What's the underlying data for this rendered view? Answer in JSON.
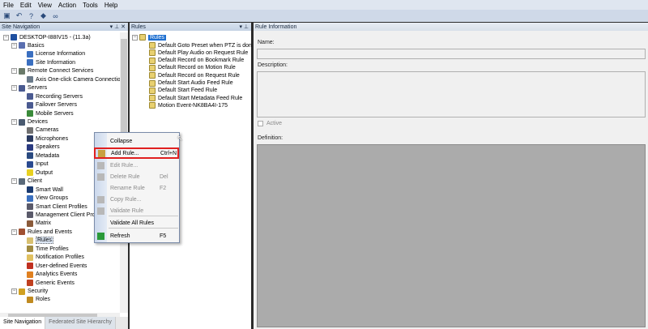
{
  "menu": [
    "File",
    "Edit",
    "View",
    "Action",
    "Tools",
    "Help"
  ],
  "toolbar": [
    "save-icon",
    "undo-icon",
    "help-icon",
    "tools-icon",
    "binoculars-icon"
  ],
  "left_panel": {
    "title": "Site Navigation",
    "tree": [
      {
        "label": "DESKTOP-I88IV15 - (11.3a)",
        "level": 0,
        "exp": "−",
        "color": "#1e4fa0"
      },
      {
        "label": "Basics",
        "level": 1,
        "exp": "−",
        "color": "#5a6fb0"
      },
      {
        "label": "License Information",
        "level": 2,
        "color": "#3a6fc0"
      },
      {
        "label": "Site Information",
        "level": 2,
        "color": "#3a6fc0"
      },
      {
        "label": "Remote Connect Services",
        "level": 1,
        "exp": "−",
        "color": "#6a7a6a"
      },
      {
        "label": "Axis One-click Camera Connectio",
        "level": 2,
        "color": "#6a7a8a"
      },
      {
        "label": "Servers",
        "level": 1,
        "exp": "−",
        "color": "#4a5a90"
      },
      {
        "label": "Recording Servers",
        "level": 2,
        "color": "#4a5a90"
      },
      {
        "label": "Failover Servers",
        "level": 2,
        "color": "#4a5a90"
      },
      {
        "label": "Mobile Servers",
        "level": 2,
        "color": "#3a8a3a"
      },
      {
        "label": "Devices",
        "level": 1,
        "exp": "−",
        "color": "#4a5a70"
      },
      {
        "label": "Cameras",
        "level": 2,
        "color": "#707070"
      },
      {
        "label": "Microphones",
        "level": 2,
        "color": "#2a3a60"
      },
      {
        "label": "Speakers",
        "level": 2,
        "color": "#2a3a80"
      },
      {
        "label": "Metadata",
        "level": 2,
        "color": "#2a4a80"
      },
      {
        "label": "Input",
        "level": 2,
        "color": "#2a4a90"
      },
      {
        "label": "Output",
        "level": 2,
        "color": "#e8d020"
      },
      {
        "label": "Client",
        "level": 1,
        "exp": "−",
        "color": "#5a6a7a"
      },
      {
        "label": "Smart Wall",
        "level": 2,
        "color": "#1a3a70"
      },
      {
        "label": "View Groups",
        "level": 2,
        "color": "#3a70c0"
      },
      {
        "label": "Smart Client Profiles",
        "level": 2,
        "color": "#5a5a6a"
      },
      {
        "label": "Management Client Prof",
        "level": 2,
        "color": "#5a5a6a"
      },
      {
        "label": "Matrix",
        "level": 2,
        "color": "#8a5a3a"
      },
      {
        "label": "Rules and Events",
        "level": 1,
        "exp": "−",
        "color": "#a05030"
      },
      {
        "label": "Rules",
        "level": 2,
        "color": "#d8c070",
        "selected": true
      },
      {
        "label": "Time Profiles",
        "level": 2,
        "color": "#a08a40"
      },
      {
        "label": "Notification Profiles",
        "level": 2,
        "color": "#e0c060"
      },
      {
        "label": "User-defined Events",
        "level": 2,
        "color": "#c03020"
      },
      {
        "label": "Analytics Events",
        "level": 2,
        "color": "#e08020"
      },
      {
        "label": "Generic Events",
        "level": 2,
        "color": "#c04020"
      },
      {
        "label": "Security",
        "level": 1,
        "exp": "−",
        "color": "#d0a020"
      },
      {
        "label": "Roles",
        "level": 2,
        "color": "#c08a20"
      }
    ],
    "tabs": [
      "Site Navigation",
      "Federated Site Hierarchy"
    ]
  },
  "mid_panel": {
    "title": "Rules",
    "root": "Rules",
    "items": [
      "Default Goto Preset when PTZ is don",
      "Default Play Audio on Request Rule",
      "Default Record on Bookmark Rule",
      "Default Record on Motion Rule",
      "Default Record on Request Rule",
      "Default Start Audio Feed Rule",
      "Default Start Feed Rule",
      "Default Start Metadata Feed Rule",
      "Motion Event-NK8BA4I-175"
    ]
  },
  "right_panel": {
    "title": "Rule Information",
    "name_label": "Name:",
    "name_value": "",
    "description_label": "Description:",
    "active_label": "Active",
    "active_checked": false,
    "definition_label": "Definition:"
  },
  "context_menu": [
    {
      "label": "Collapse",
      "shortcut": "",
      "enabled": true
    },
    {
      "label": "Add Rule...",
      "shortcut": "Ctrl+N",
      "enabled": true,
      "highlighted": true
    },
    {
      "label": "Edit Rule...",
      "shortcut": "",
      "enabled": false
    },
    {
      "label": "Delete Rule",
      "shortcut": "Del",
      "enabled": false
    },
    {
      "label": "Rename Rule",
      "shortcut": "F2",
      "enabled": false
    },
    {
      "label": "Copy Rule...",
      "shortcut": "",
      "enabled": false
    },
    {
      "label": "Validate Rule",
      "shortcut": "",
      "enabled": false
    },
    {
      "label": "Validate All Rules",
      "shortcut": "",
      "enabled": true
    },
    {
      "label": "Refresh",
      "shortcut": "F5",
      "enabled": true
    }
  ],
  "highlight_color": "#e02020"
}
